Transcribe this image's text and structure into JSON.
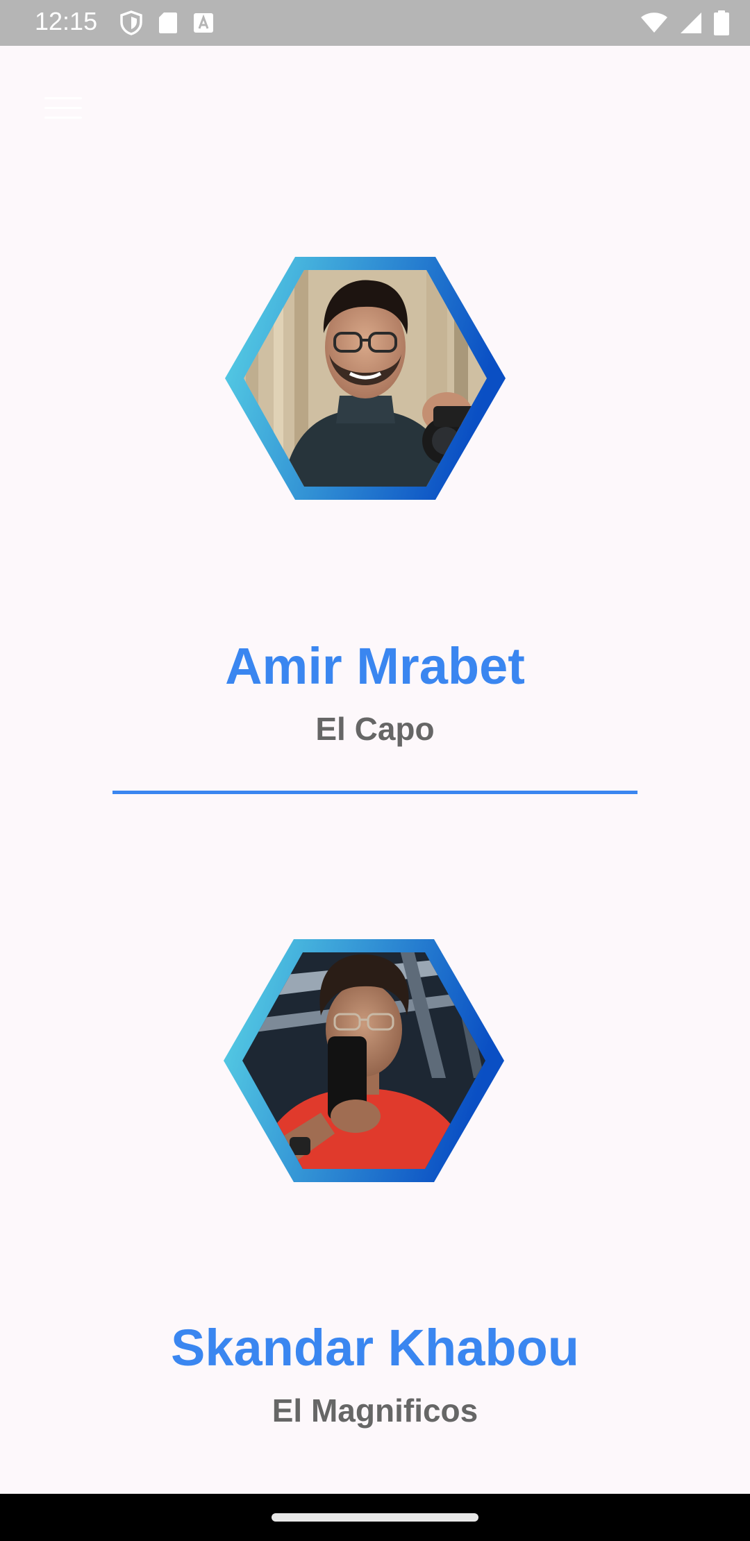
{
  "status_bar": {
    "time": "12:15",
    "icons_left": [
      "shield-icon",
      "sd-card-icon",
      "keyboard-a-icon"
    ],
    "icons_right": [
      "wifi-icon",
      "signal-icon",
      "battery-icon"
    ]
  },
  "menu": {
    "icon": "hamburger-menu-icon"
  },
  "profiles": [
    {
      "name": "Amir Mrabet",
      "title": "El Capo",
      "photo": "profile-photo-amir"
    },
    {
      "name": "Skandar Khabou",
      "title": "El Magnificos",
      "photo": "profile-photo-skandar"
    }
  ],
  "colors": {
    "accent": "#3a86f0",
    "subtitle": "#666666",
    "background": "#fdf8fb",
    "hex_gradient_start": "#5bd6e6",
    "hex_gradient_end": "#0a4fc4"
  }
}
